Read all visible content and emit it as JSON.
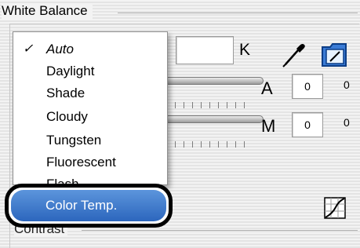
{
  "group": {
    "title": "White Balance"
  },
  "temperature": {
    "value": "",
    "unit": "K"
  },
  "tint_a": {
    "letter": "A",
    "value": "0",
    "side_value": "0"
  },
  "tint_m": {
    "letter": "M",
    "value": "0",
    "side_value": "0"
  },
  "menu": {
    "check_mark": "✓",
    "items": [
      "Auto",
      "Daylight",
      "Shade",
      "Cloudy",
      "Tungsten",
      "Fluorescent",
      "Flash"
    ],
    "selected": "Color Temp."
  },
  "contrast": {
    "label": "Contrast"
  },
  "icons": [
    "eyedropper-icon",
    "folder-icon",
    "tone-curve-icon"
  ],
  "colors": {
    "highlight": "#2c66bd",
    "callout_border": "#000000"
  }
}
